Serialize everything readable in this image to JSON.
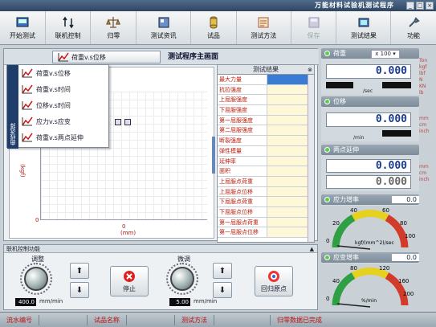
{
  "window": {
    "title": "万能材料试验机测试程序"
  },
  "toolbar": [
    {
      "label": "开始测试",
      "icon": "start-test-icon"
    },
    {
      "label": "联机控制",
      "icon": "online-control-icon"
    },
    {
      "label": "归零",
      "icon": "balance-zero-icon"
    },
    {
      "label": "测试资讯",
      "icon": "test-info-icon"
    },
    {
      "label": "试品",
      "icon": "specimen-icon"
    },
    {
      "label": "测试方法",
      "icon": "test-method-icon"
    },
    {
      "label": "保存",
      "icon": "save-icon",
      "disabled": true
    },
    {
      "label": "测试结果",
      "icon": "test-result-icon"
    },
    {
      "label": "功能",
      "icon": "function-icon"
    }
  ],
  "main": {
    "curve_button": "荷重v.s位移",
    "caption": "测试程序主画面",
    "x_zero": "0",
    "y_zero": "0",
    "y_unit": "(kgf)",
    "x_unit": "(mm)"
  },
  "menu": {
    "strip_label": "曲线选择",
    "items": [
      "荷重v.s位移",
      "荷重v.s时间",
      "位移v.s时间",
      "应力v.s应变",
      "荷重v.s两点延伸"
    ]
  },
  "results": {
    "title": "测试结果",
    "rows": [
      "最大力量",
      "抗拉强度",
      "上屈服强度",
      "下屈服强度",
      "第一屈服强度",
      "第二屈服强度",
      "断裂强度",
      "弹性模量",
      "延伸率",
      "面积",
      "上屈服点荷重",
      "上屈服点位移",
      "下屈服点荷重",
      "下屈服点位移",
      "第一屈服点荷重",
      "第一屈服点位移"
    ]
  },
  "right": {
    "load": {
      "title": "荷重",
      "unit_select": "x 100",
      "value": "0.000",
      "rate_unit": "/sec",
      "units": "Ton\nkgf\nlbf\nN\nKN\nlb"
    },
    "displacement": {
      "title": "位移",
      "value": "0.000",
      "rate_unit": "/min",
      "units": "mm\ncm\ninch"
    },
    "extension": {
      "title": "两点延伸",
      "value1": "0.000",
      "value2": "0.000",
      "units": "mm\ncm\ninch"
    },
    "stress_rate": {
      "title": "应力增率",
      "value": "0.0",
      "unit": "kgf/(mm^2)/sec",
      "scale": [
        "0",
        "20",
        "40",
        "60",
        "80",
        "100"
      ]
    },
    "strain_rate": {
      "title": "应变增率",
      "value": "0.0",
      "unit": "%/min",
      "scale": [
        "0",
        "40",
        "80",
        "120",
        "160",
        "200"
      ]
    }
  },
  "control": {
    "title": "联机控制功能",
    "coarse_label": "调整",
    "fine_label": "微调",
    "coarse_speed": "400.0",
    "fine_speed": "5.00",
    "speed_unit": "mm/min",
    "stop_label": "停止",
    "home_label": "回归原点"
  },
  "status": {
    "serial": "流水编号",
    "specimen": "试品名称",
    "method": "测试方法",
    "message": "归零数据已完成"
  }
}
